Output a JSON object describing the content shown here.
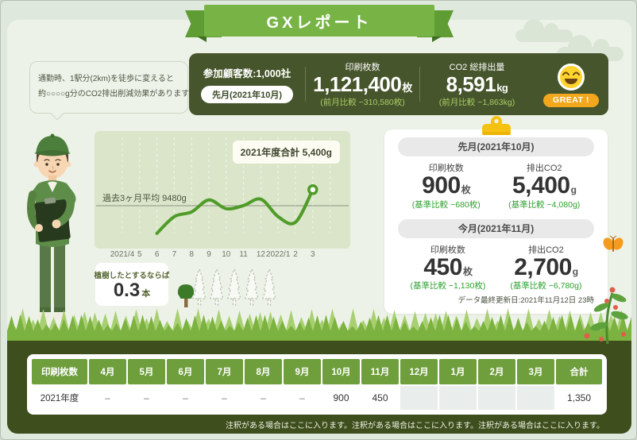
{
  "page": {
    "ribbon_title": "GXレポート"
  },
  "speech_bubble": {
    "line1": "通勤時、1駅分(2km)を徒歩に変えると",
    "line2": "約○○○○g分のCO2排出削減効果があります"
  },
  "stats_bar": {
    "participants_label": "参加顧客数:1,000社",
    "period_pill": "先月(2021年10月)",
    "print": {
      "label": "印刷枚数",
      "value": "1,121,400",
      "unit": "枚",
      "comparison": "(前月比較 −310,580枚)"
    },
    "co2": {
      "label": "CO2 総排出量",
      "value": "8,591",
      "unit": "kg",
      "comparison": "(前月比較 −1,863kg)"
    },
    "rating": {
      "icon": "smiley-face",
      "badge": "GREAT !"
    }
  },
  "chart_data": {
    "type": "line",
    "x": [
      "2021/4",
      "5",
      "6",
      "7",
      "8",
      "9",
      "10",
      "11",
      "12",
      "2022/1",
      "2",
      "3"
    ],
    "series": [
      {
        "name": "排出CO2 (g)",
        "values": [
          null,
          null,
          6000,
          8100,
          8700,
          10200,
          9100,
          9500,
          10300,
          8100,
          7400,
          11500
        ]
      }
    ],
    "annotation": "2021年度合計 5,400g",
    "average_line": {
      "label": "過去3ヶ月平均 9480g",
      "value": 9480
    },
    "ylim": [
      5500,
      12500
    ],
    "grid": "vertical-dashed",
    "legend": "none",
    "line_color": "#4f9b28"
  },
  "planting": {
    "label": "植樹したとするならば",
    "value": "0.3",
    "unit": "本",
    "trees_total": 6,
    "trees_filled": 1
  },
  "monthly_panel": {
    "last_month": {
      "header": "先月(2021年10月)",
      "print": {
        "label": "印刷枚数",
        "value": "900",
        "unit": "枚",
        "comparison": "(基準比較 −680枚)"
      },
      "co2": {
        "label": "排出CO2",
        "value": "5,400",
        "unit": "g",
        "comparison": "(基準比較 −4,080g)"
      }
    },
    "this_month": {
      "header": "今月(2021年11月)",
      "print": {
        "label": "印刷枚数",
        "value": "450",
        "unit": "枚",
        "comparison": "(基準比較 −1,130枚)"
      },
      "co2": {
        "label": "排出CO2",
        "value": "2,700",
        "unit": "g",
        "comparison": "(基準比較 −6,780g)"
      }
    },
    "updated": "データ最終更新日:2021年11月12日 23時"
  },
  "table": {
    "header": [
      "印刷枚数",
      "4月",
      "5月",
      "6月",
      "7月",
      "8月",
      "9月",
      "10月",
      "11月",
      "12月",
      "1月",
      "2月",
      "3月",
      "合計"
    ],
    "rows": [
      {
        "label": "2021年度",
        "values": [
          "–",
          "–",
          "–",
          "–",
          "–",
          "–",
          "900",
          "450",
          "",
          "",
          "",
          "",
          "1,350"
        ]
      }
    ]
  },
  "footer_note": "注釈がある場合はここに入ります。注釈がある場合はここに入ります。注釈がある場合はここに入ります。",
  "colors": {
    "ribbon_green": "#78b445",
    "dark_olive_bar": "#46552b",
    "comparison_green": "#2fa02f",
    "accent_light_green": "#a9cc67",
    "badge_yellow": "#f2a71d",
    "table_header_green": "#6f9e3d",
    "chart_panel": "#dae5c9",
    "dark_band": "#3e4e1d"
  }
}
